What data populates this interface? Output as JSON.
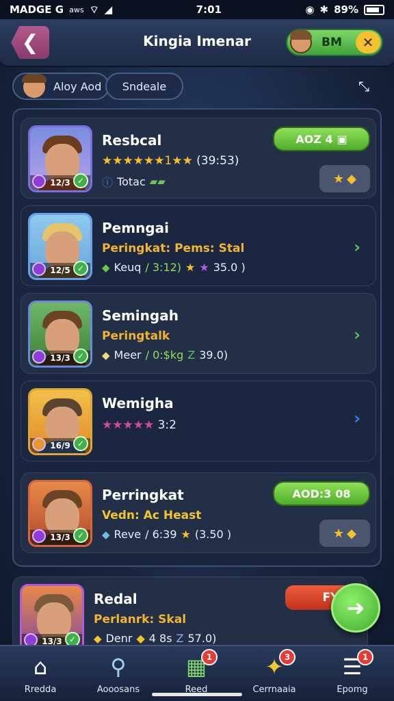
{
  "status_bar": {
    "left_text": "MADGE G",
    "left_sub": "aws",
    "time": "7:01",
    "battery_text": "89%"
  },
  "header": {
    "title": "Kingia Imenar",
    "currency_value": "BM",
    "back_glyph": "❮",
    "close_glyph": "✕"
  },
  "filters": {
    "chip_one": "Aloy Aod",
    "chip_two": "Sndeale",
    "pin_glyph": "⤡"
  },
  "cards": [
    {
      "name": "Resbcal",
      "level": "12/3",
      "stars_text": "★★★★★★1★★",
      "rating": "(39:53)",
      "stat_label": "Totac",
      "badge_text": "AOZ 4",
      "badge_icon": "▣",
      "reward_icon": "★",
      "reward_icon_2": "◆"
    },
    {
      "name": "Pemngai",
      "level": "12/5",
      "sub": "Peringkat: Pems: Stal",
      "stat_label": "Keuq",
      "stat_mid": "/ 3:12)",
      "stat_value": "35.0 )"
    },
    {
      "name": "Semingah",
      "level": "13/3",
      "sub": "Peringtalk",
      "stat_label": "Meer",
      "stat_mid": "/ 0:$kg",
      "stat_value": "39.0)"
    },
    {
      "name": "Wemigha",
      "level": "16/9",
      "stars_text": "★★★★★",
      "stat_value": "3:2"
    },
    {
      "name": "Perringkat",
      "level": "13/3",
      "sub": "Vedn: Ac Heast",
      "stat_label": "Reve",
      "stat_mid": "/ 6:39",
      "stat_value": "(3.50 )",
      "badge_text": "AOD:3",
      "badge_extra": "08"
    }
  ],
  "last_card": {
    "name": "Redal",
    "level": "13/3",
    "sub": "Perlanrk: Skal",
    "stat_label": "Denr",
    "stat_mid": "4 8s",
    "stat_value": "57.0)",
    "badge_text": "FYA"
  },
  "fab": {
    "glyph": "➜"
  },
  "nav": [
    {
      "label": "Rredda",
      "icon": "⌂"
    },
    {
      "label": "Aooosans",
      "icon": "⚲"
    },
    {
      "label": "Reed",
      "icon": "▦",
      "badge": "1"
    },
    {
      "label": "Cerrnaaia",
      "icon": "✦",
      "badge": "3"
    },
    {
      "label": "Epomg",
      "icon": "☰",
      "badge": "1"
    }
  ],
  "colors": {
    "accent_green": "#52c85a",
    "gold": "#f2b531",
    "background": "#182640"
  }
}
